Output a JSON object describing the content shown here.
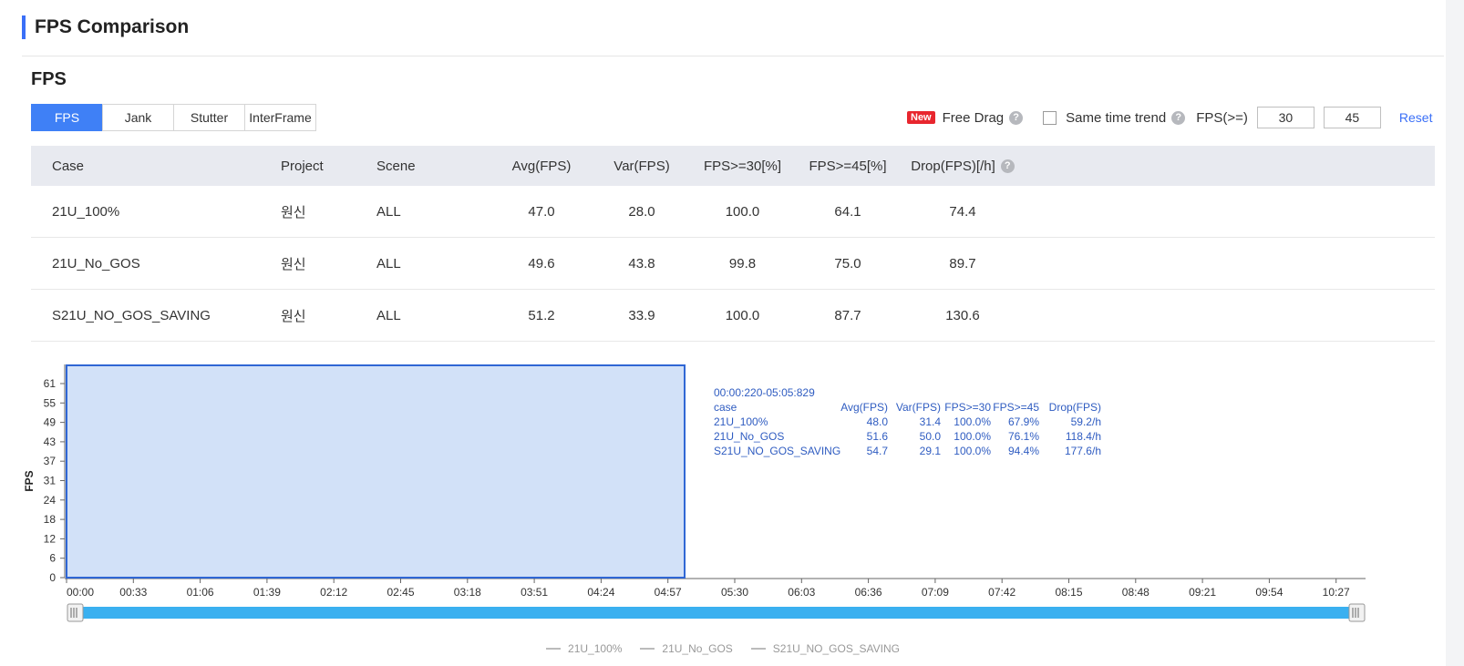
{
  "page": {
    "title": "FPS Comparison",
    "section_title": "FPS"
  },
  "tabs": [
    {
      "label": "FPS",
      "active": true
    },
    {
      "label": "Jank",
      "active": false
    },
    {
      "label": "Stutter",
      "active": false
    },
    {
      "label": "InterFrame",
      "active": false
    }
  ],
  "toolbar": {
    "new_badge": "New",
    "free_drag": "Free Drag",
    "same_time_trend": "Same time trend",
    "fps_label": "FPS(>=)",
    "fps_value_1": "30",
    "fps_value_2": "45",
    "reset": "Reset"
  },
  "table": {
    "headers": {
      "case": "Case",
      "project": "Project",
      "scene": "Scene",
      "avg": "Avg(FPS)",
      "var": "Var(FPS)",
      "p30": "FPS>=30[%]",
      "p45": "FPS>=45[%]",
      "drop": "Drop(FPS)[/h]"
    },
    "rows": [
      {
        "case": "21U_100%",
        "project": "원신",
        "scene": "ALL",
        "avg": "47.0",
        "var": "28.0",
        "p30": "100.0",
        "p45": "64.1",
        "drop": "74.4"
      },
      {
        "case": "21U_No_GOS",
        "project": "원신",
        "scene": "ALL",
        "avg": "49.6",
        "var": "43.8",
        "p30": "99.8",
        "p45": "75.0",
        "drop": "89.7"
      },
      {
        "case": "S21U_NO_GOS_SAVING",
        "project": "원신",
        "scene": "ALL",
        "avg": "51.2",
        "var": "33.9",
        "p30": "100.0",
        "p45": "87.7",
        "drop": "130.6"
      }
    ]
  },
  "chart_data": {
    "type": "area",
    "ylabel": "FPS",
    "y_ticks": [
      "0",
      "6",
      "12",
      "18",
      "24",
      "31",
      "37",
      "43",
      "49",
      "55",
      "61"
    ],
    "x_ticks": [
      "00:00",
      "00:33",
      "01:06",
      "01:39",
      "02:12",
      "02:45",
      "03:18",
      "03:51",
      "04:24",
      "04:57",
      "05:30",
      "06:03",
      "06:36",
      "07:09",
      "07:42",
      "08:15",
      "08:48",
      "09:21",
      "09:54",
      "10:27"
    ],
    "selection": {
      "from_tick": 0,
      "to_tick": 9.25
    },
    "legend": [
      "21U_100%",
      "21U_No_GOS",
      "S21U_NO_GOS_SAVING"
    ],
    "selection_color": "#d2e1f8",
    "selection_border": "#2f66d4",
    "slider_color": "#3ab0f0"
  },
  "tooltip": {
    "range": "00:00:220-05:05:829",
    "headers": {
      "case": "case",
      "avg": "Avg(FPS)",
      "var": "Var(FPS)",
      "p30": "FPS>=30",
      "p45": "FPS>=45",
      "drop": "Drop(FPS)"
    },
    "rows": [
      {
        "case": "21U_100%",
        "avg": "48.0",
        "var": "31.4",
        "p30": "100.0%",
        "p45": "67.9%",
        "drop": "59.2/h"
      },
      {
        "case": "21U_No_GOS",
        "avg": "51.6",
        "var": "50.0",
        "p30": "100.0%",
        "p45": "76.1%",
        "drop": "118.4/h"
      },
      {
        "case": "S21U_NO_GOS_SAVING",
        "avg": "54.7",
        "var": "29.1",
        "p30": "100.0%",
        "p45": "94.4%",
        "drop": "177.6/h"
      }
    ]
  }
}
